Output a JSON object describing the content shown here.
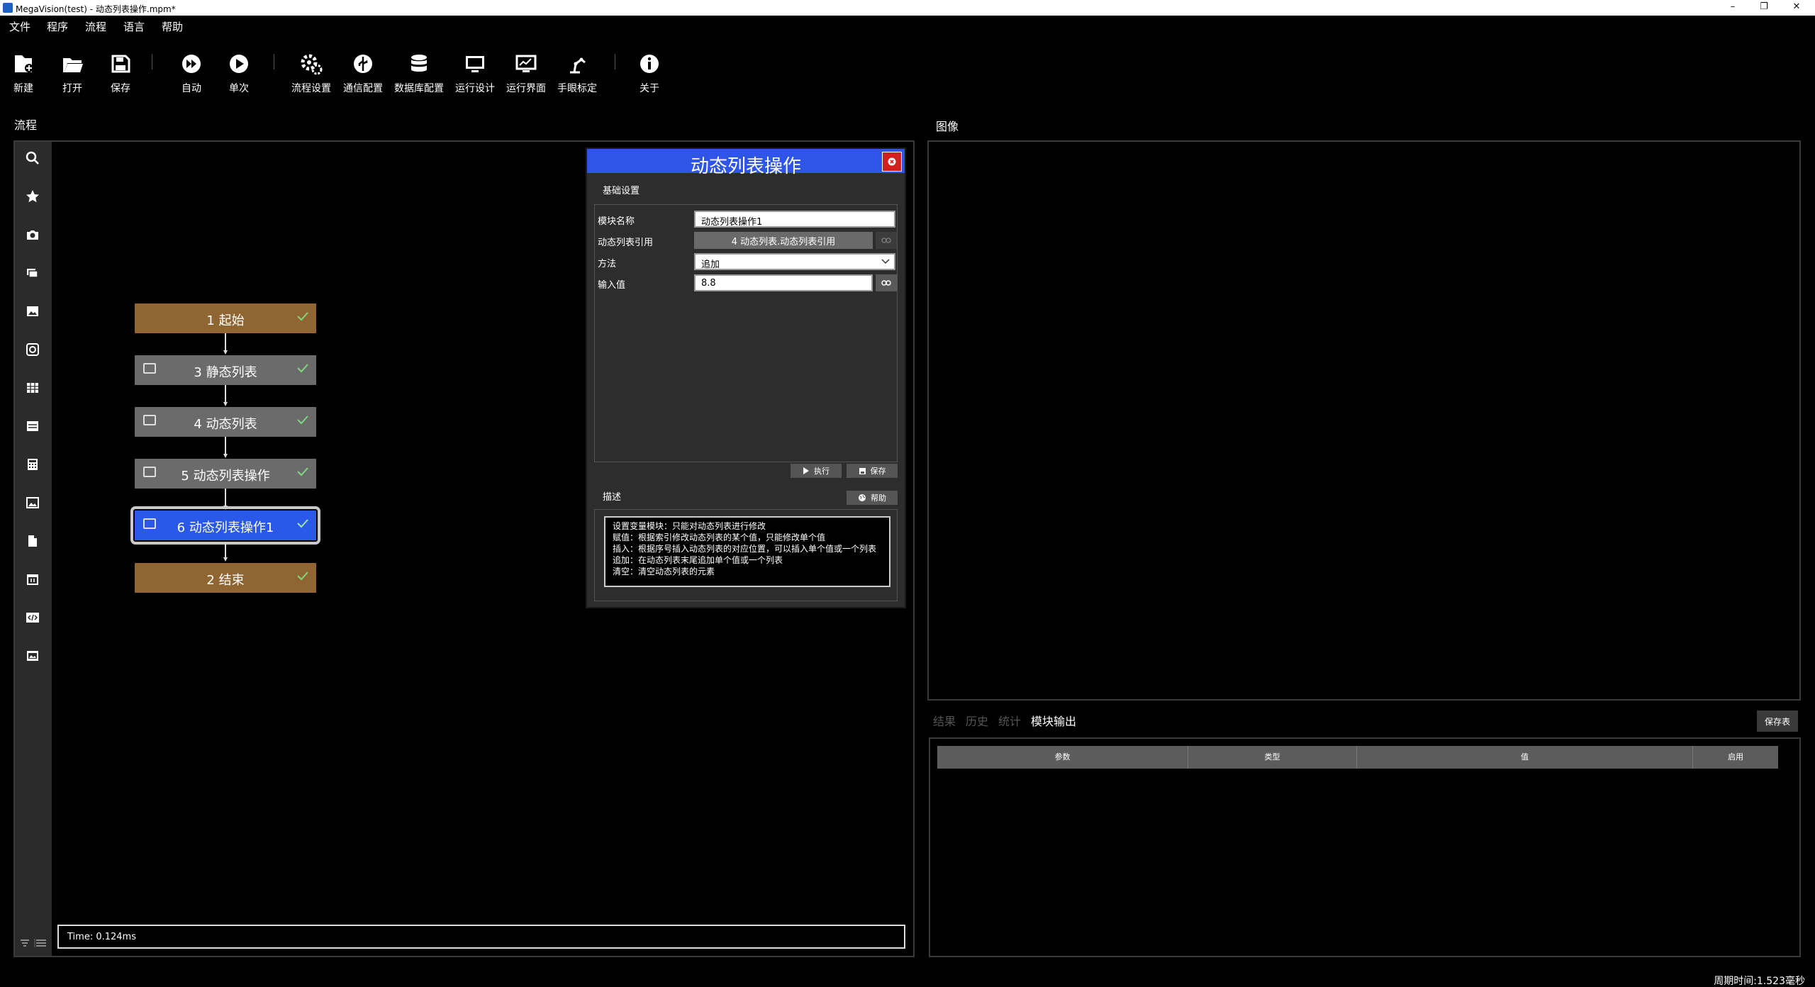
{
  "window": {
    "title": "MegaVision(test) - 动态列表操作.mpm*",
    "controls": [
      "–",
      "❐",
      "✕"
    ]
  },
  "menu": [
    "文件",
    "程序",
    "流程",
    "语言",
    "帮助"
  ],
  "toolbar": [
    {
      "label": "新建",
      "icon": "new-file-icon"
    },
    {
      "label": "打开",
      "icon": "folder-open-icon"
    },
    {
      "label": "保存",
      "icon": "save-icon"
    },
    {
      "label": "自动",
      "icon": "auto-run-icon"
    },
    {
      "label": "单次",
      "icon": "play-once-icon"
    },
    {
      "label": "流程设置",
      "icon": "flow-settings-icon"
    },
    {
      "label": "通信配置",
      "icon": "usb-icon"
    },
    {
      "label": "数据库配置",
      "icon": "database-icon"
    },
    {
      "label": "运行设计",
      "icon": "monitor-icon"
    },
    {
      "label": "运行界面",
      "icon": "chart-monitor-icon"
    },
    {
      "label": "手眼标定",
      "icon": "robot-arm-icon"
    },
    {
      "label": "关于",
      "icon": "info-icon"
    }
  ],
  "flow": {
    "title": "流程",
    "sidebar_icons": [
      "search-icon",
      "star-icon",
      "camera-icon",
      "layers-icon",
      "image-tool-icon",
      "target-icon",
      "grid-icon",
      "list-icon",
      "calculator-icon",
      "picture-icon",
      "file-icon",
      "calendar-icon",
      "code-icon",
      "image-stack-icon"
    ],
    "nodes": [
      {
        "label": "1 起始",
        "kind": "start"
      },
      {
        "label": "3 静态列表",
        "kind": "gray"
      },
      {
        "label": "4 动态列表",
        "kind": "gray"
      },
      {
        "label": "5 动态列表操作",
        "kind": "gray"
      },
      {
        "label": "6 动态列表操作1",
        "kind": "active"
      },
      {
        "label": "2 结束",
        "kind": "end"
      }
    ],
    "time": "Time: 0.124ms"
  },
  "dialog": {
    "title": "动态列表操作",
    "basic_settings": "基础设置",
    "fields": {
      "module_name_label": "模块名称",
      "module_name_value": "动态列表操作1",
      "ref_label": "动态列表引用",
      "ref_value": "4 动态列表.动态列表引用",
      "method_label": "方法",
      "method_value": "追加",
      "input_label": "输入值",
      "input_value": "8.8"
    },
    "run_button": "执行",
    "save_button": "保存",
    "desc_title": "描述",
    "help_button": "帮助",
    "description": [
      "设置变量模块：只能对动态列表进行修改",
      "赋值：根据索引修改动态列表的某个值，只能修改单个值",
      "插入：根据序号插入动态列表的对应位置，可以插入单个值或一个列表",
      "追加：在动态列表末尾追加单个值或一个列表",
      "清空：清空动态列表的元素"
    ]
  },
  "image_panel": {
    "title": "图像"
  },
  "results": {
    "tabs": [
      {
        "label": "结果",
        "active": false
      },
      {
        "label": "历史",
        "active": false
      },
      {
        "label": "统计",
        "active": false
      },
      {
        "label": "模块输出",
        "active": true
      }
    ],
    "save_table": "保存表",
    "columns": [
      "参数",
      "类型",
      "值",
      "启用"
    ]
  },
  "status": {
    "cycle_time": "周期时间:1.523毫秒"
  }
}
